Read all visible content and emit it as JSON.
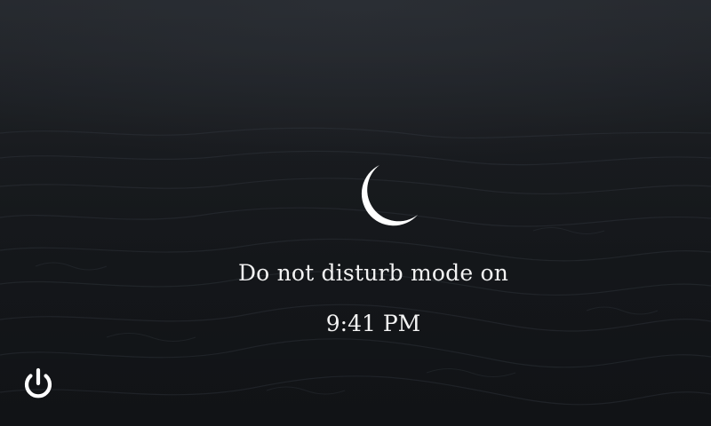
{
  "status": {
    "message": "Do not disturb mode on",
    "time": "9:41 PM"
  },
  "icons": {
    "status_icon": "moon-icon",
    "power_icon": "power-icon"
  },
  "colors": {
    "background": "#1c1f24",
    "foreground": "#ffffff"
  }
}
